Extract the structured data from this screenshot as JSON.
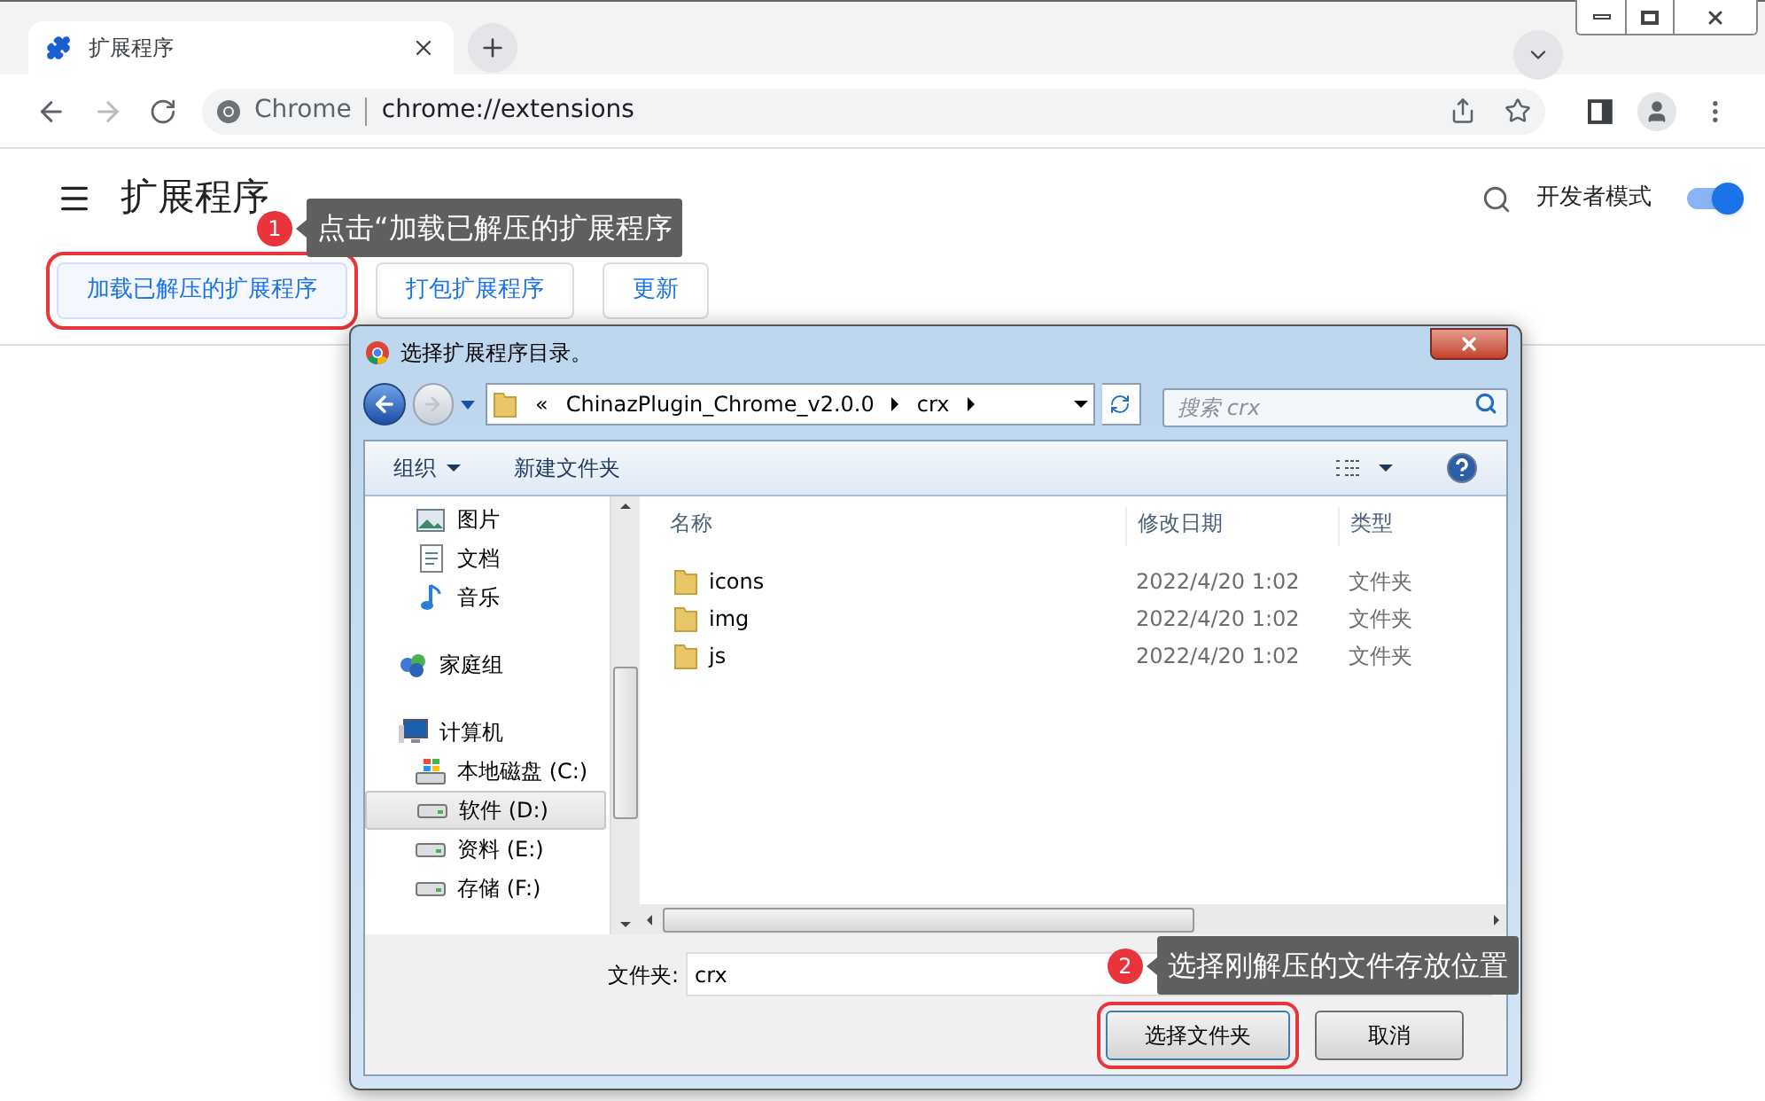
{
  "browser": {
    "tab": {
      "title": "扩展程序"
    },
    "address": {
      "site": "Chrome",
      "url": "chrome://extensions"
    }
  },
  "page": {
    "title": "扩展程序",
    "developer_mode": {
      "label": "开发者模式",
      "on": true
    },
    "buttons": [
      {
        "label": "加载已解压的扩展程序",
        "highlighted": true
      },
      {
        "label": "打包扩展程序",
        "highlighted": false
      },
      {
        "label": "更新",
        "highlighted": false
      }
    ]
  },
  "dialog": {
    "title": "选择扩展程序目录。",
    "breadcrumb": [
      "«",
      "ChinazPlugin_Chrome_v2.0.0",
      "crx"
    ],
    "search": {
      "placeholder": "搜索 crx"
    },
    "toolbar": {
      "organize": "组织",
      "new_folder": "新建文件夹"
    },
    "nav": [
      {
        "label": "图片",
        "kind": "pictures",
        "selected": false
      },
      {
        "label": "文档",
        "kind": "documents",
        "selected": false
      },
      {
        "label": "音乐",
        "kind": "music",
        "selected": false
      },
      {
        "label": "家庭组",
        "kind": "homegroup",
        "selected": false
      },
      {
        "label": "计算机",
        "kind": "computer",
        "selected": false
      },
      {
        "label": "本地磁盘 (C:)",
        "kind": "system-drive",
        "selected": false
      },
      {
        "label": "软件 (D:)",
        "kind": "drive",
        "selected": true
      },
      {
        "label": "资料 (E:)",
        "kind": "drive",
        "selected": false
      },
      {
        "label": "存储 (F:)",
        "kind": "drive",
        "selected": false
      }
    ],
    "columns": [
      "名称",
      "修改日期",
      "类型"
    ],
    "files": [
      {
        "name": "icons",
        "modified": "2022/4/20 1:02",
        "type": "文件夹"
      },
      {
        "name": "img",
        "modified": "2022/4/20 1:02",
        "type": "文件夹"
      },
      {
        "name": "js",
        "modified": "2022/4/20 1:02",
        "type": "文件夹"
      }
    ],
    "folder_field": {
      "label": "文件夹:",
      "value": "crx"
    },
    "buttons": [
      {
        "label": "选择文件夹",
        "highlighted": true
      },
      {
        "label": "取消",
        "highlighted": false
      }
    ]
  },
  "callouts": [
    {
      "number": "1",
      "text": "点击“加载已解压的扩展程序"
    },
    {
      "number": "2",
      "text": "选择刚解压的文件存放位置"
    }
  ]
}
